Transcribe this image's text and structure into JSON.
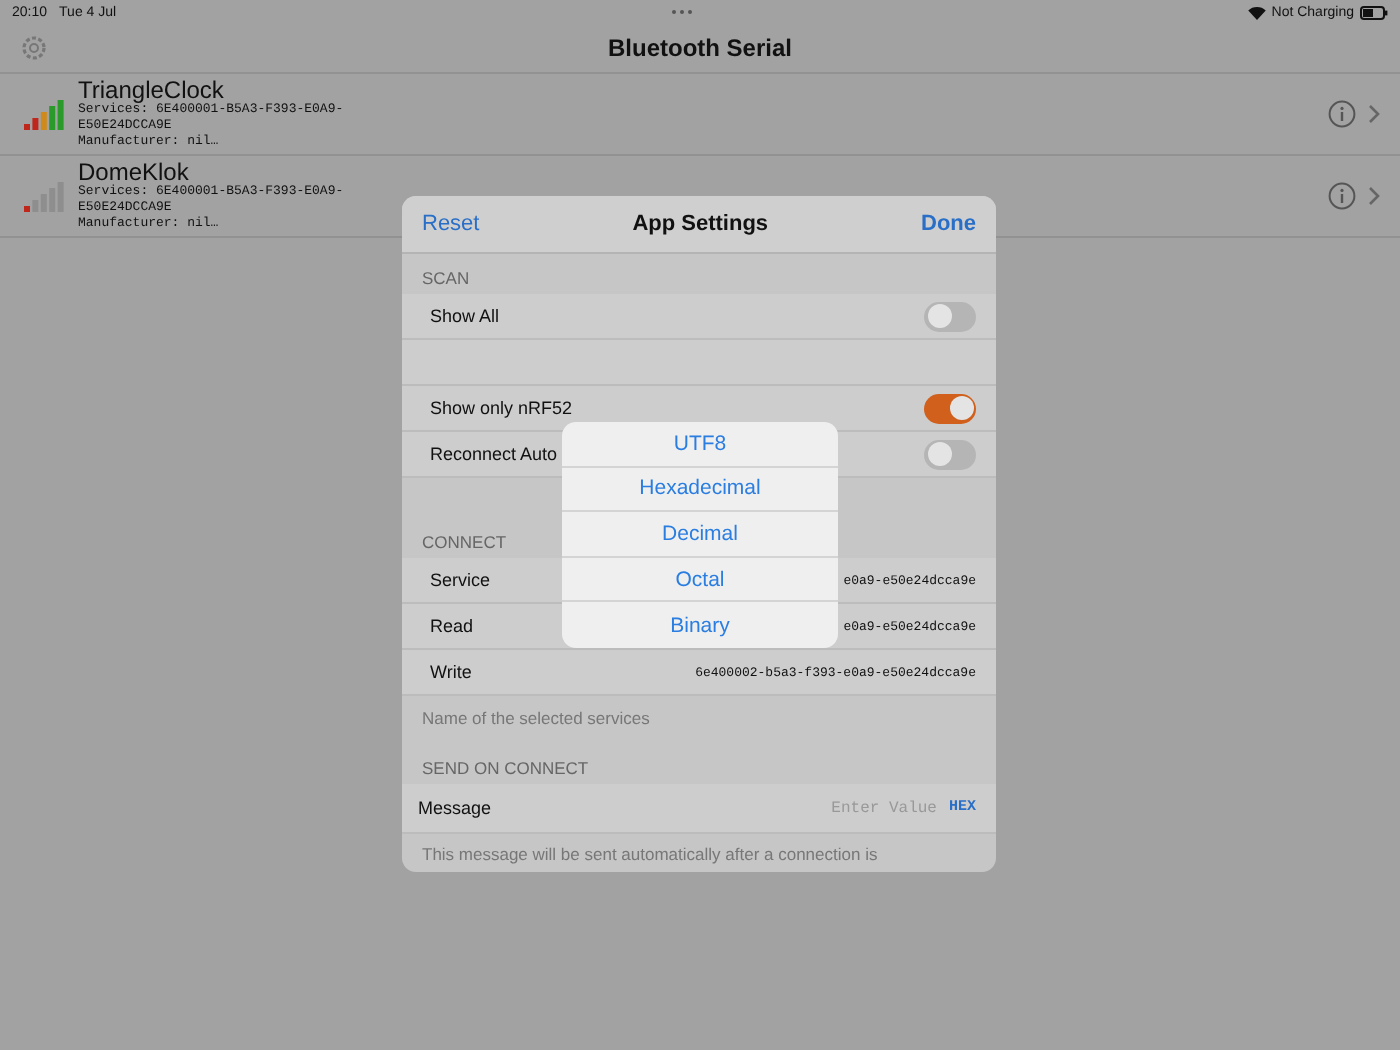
{
  "status_bar": {
    "time": "20:10",
    "date": "Tue 4 Jul",
    "battery": "Not Charging"
  },
  "nav": {
    "title": "Bluetooth Serial"
  },
  "devices": [
    {
      "name": "TriangleClock",
      "services": "Services: 6E400001-B5A3-F393-E0A9-",
      "services_2": "E50E24DCCA9E",
      "manufacturer": "Manufacturer: nil…",
      "kind": "strong"
    },
    {
      "name": "DomeKlok",
      "services": "Services: 6E400001-B5A3-F393-E0A9-",
      "services_2": "E50E24DCCA9E",
      "manufacturer": "Manufacturer: nil…",
      "kind": "weak"
    }
  ],
  "settings": {
    "reset": "Reset",
    "title": "App Settings",
    "done": "Done",
    "scan_header": "SCAN",
    "scan_rows": [
      {
        "label": "Show All",
        "checked": false
      },
      {
        "label": "Show only nRF52",
        "checked": true
      },
      {
        "label": "Reconnect Auto",
        "checked": false
      }
    ],
    "connect_header": "CONNECT",
    "connect_rows": [
      {
        "label": "Service",
        "value": "e0a9-e50e24dcca9e"
      },
      {
        "label": "Read",
        "value": "e0a9-e50e24dcca9e"
      },
      {
        "label": "Write",
        "value": "6e400002-b5a3-f393-e0a9-e50e24dcca9e"
      }
    ],
    "connect_footer": "Name of the selected services",
    "send_header": "SEND ON CONNECT",
    "message": {
      "label": "Message",
      "placeholder": "Enter Value",
      "format": "HEX"
    },
    "send_footer": "This message will be sent automatically after a connection is"
  },
  "format_menu": [
    "UTF8",
    "Hexadecimal",
    "Decimal",
    "Octal",
    "Binary"
  ]
}
